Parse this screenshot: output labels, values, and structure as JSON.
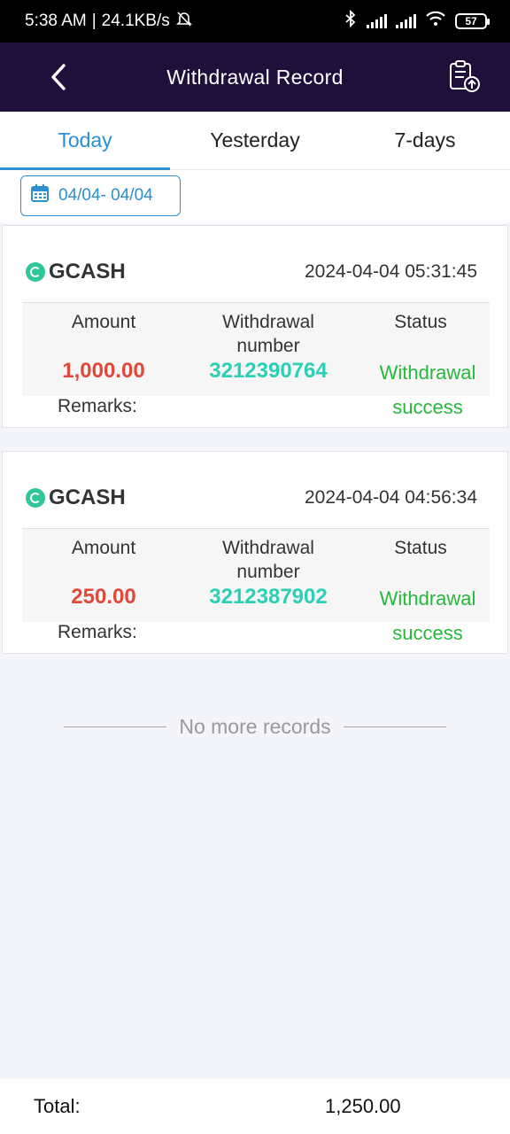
{
  "status_bar": {
    "time": "5:38 AM",
    "speed": "24.1KB/s",
    "battery": "57"
  },
  "header": {
    "title": "Withdrawal Record"
  },
  "tabs": [
    {
      "label": "Today",
      "active": true
    },
    {
      "label": "Yesterday",
      "active": false
    },
    {
      "label": "7-days",
      "active": false
    }
  ],
  "date_filter": {
    "label": "04/04- 04/04"
  },
  "columns": {
    "amount": "Amount",
    "withdrawal_number_line1": "Withdrawal",
    "withdrawal_number_line2": "number",
    "status": "Status",
    "remarks": "Remarks:"
  },
  "records": [
    {
      "method": "GCASH",
      "datetime": "2024-04-04 05:31:45",
      "amount": "1,000.00",
      "withdrawal_number": "3212390764",
      "status_line1": "Withdrawal",
      "status_line2": "success"
    },
    {
      "method": "GCASH",
      "datetime": "2024-04-04 04:56:34",
      "amount": "250.00",
      "withdrawal_number": "3212387902",
      "status_line1": "Withdrawal",
      "status_line2": "success"
    }
  ],
  "no_more_text": "No more records",
  "footer": {
    "total_label": "Total:",
    "total_value": "1,250.00"
  },
  "colors": {
    "header_bg": "#1e0f3b",
    "accent": "#2b8fd0",
    "amount": "#e0483a",
    "number": "#2ad0b4",
    "success": "#26b83a"
  }
}
